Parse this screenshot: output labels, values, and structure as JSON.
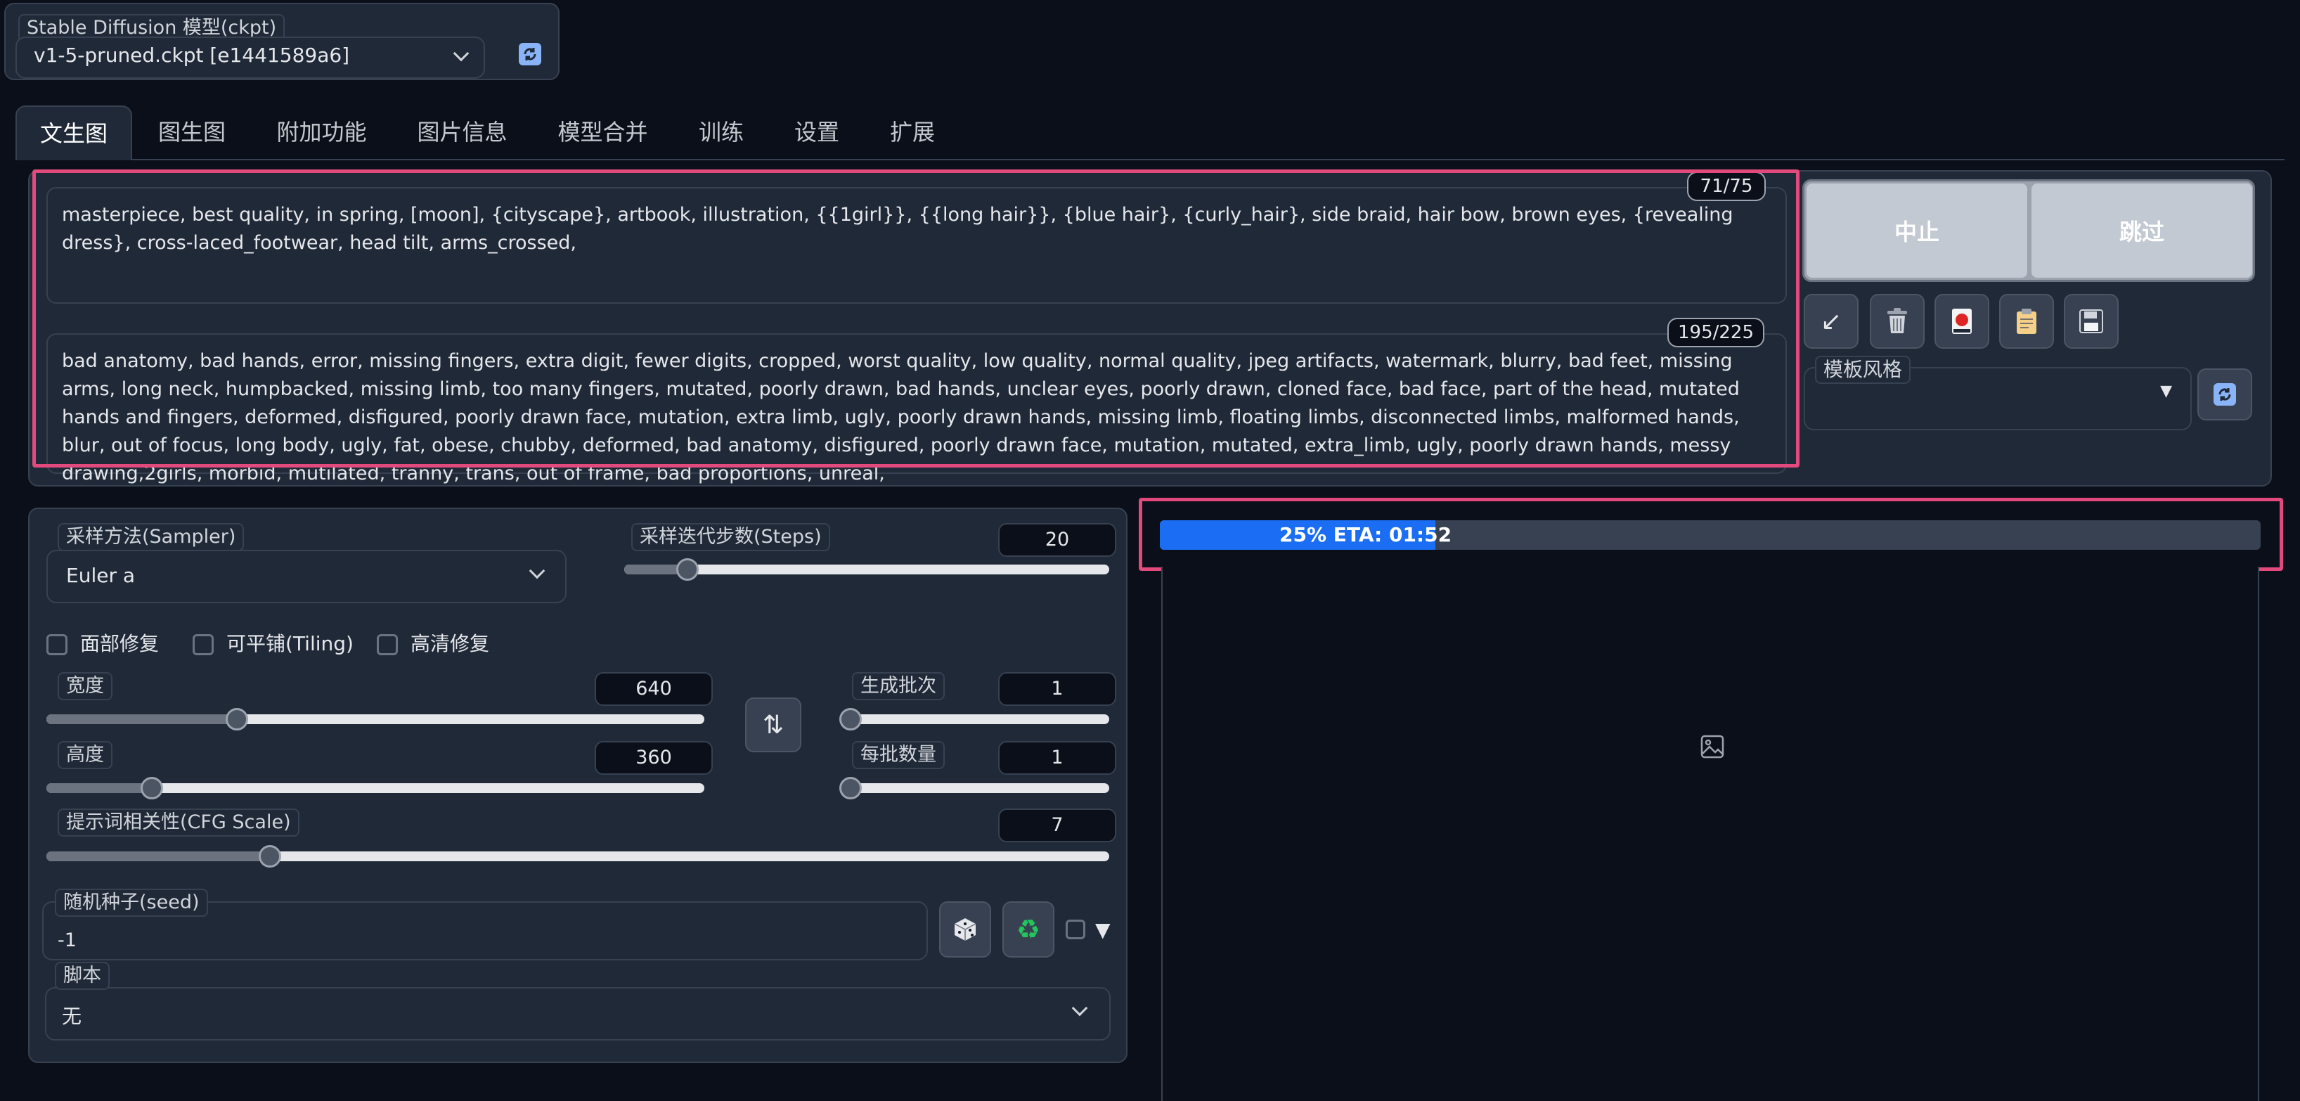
{
  "model": {
    "label": "Stable Diffusion 模型(ckpt)",
    "value": "v1-5-pruned.ckpt [e1441589a6]"
  },
  "tabs": [
    {
      "label": "文生图",
      "active": true
    },
    {
      "label": "图生图"
    },
    {
      "label": "附加功能"
    },
    {
      "label": "图片信息"
    },
    {
      "label": "模型合并"
    },
    {
      "label": "训练"
    },
    {
      "label": "设置"
    },
    {
      "label": "扩展"
    }
  ],
  "prompt": {
    "counter": "71/75",
    "text": "masterpiece, best quality, in spring, [moon], {cityscape}, artbook, illustration, {{1girl}}, {{long hair}}, {blue hair}, {curly_hair}, side braid, hair bow, brown eyes, {revealing dress}, cross-laced_footwear, head tilt, arms_crossed,"
  },
  "negative_prompt": {
    "counter": "195/225",
    "text": "bad anatomy, bad hands, error, missing fingers, extra digit, fewer digits, cropped, worst quality, low quality, normal quality, jpeg artifacts, watermark, blurry, bad feet, missing arms, long neck, humpbacked, missing limb, too many fingers, mutated, poorly drawn, bad hands, unclear eyes, poorly drawn, cloned face, bad face, part of the head, mutated hands and fingers, deformed, disfigured, poorly drawn face, mutation, extra limb, ugly, poorly drawn hands, missing limb, floating limbs, disconnected limbs, malformed hands, blur, out of focus, long body, ugly, fat, obese, chubby, deformed, bad anatomy, disfigured, poorly drawn face, mutation, mutated, extra_limb, ugly, poorly drawn hands, messy drawing,2girls, morbid, mutilated, tranny, trans, out of frame, bad proportions, unreal,"
  },
  "actions": {
    "interrupt": "中止",
    "skip": "跳过"
  },
  "style": {
    "label": "模板风格"
  },
  "sampler": {
    "label": "采样方法(Sampler)",
    "value": "Euler a"
  },
  "steps": {
    "label": "采样迭代步数(Steps)",
    "value": "20",
    "fraction": 0.13
  },
  "options": {
    "face_restore": "面部修复",
    "tiling": "可平铺(Tiling)",
    "hires_fix": "高清修复"
  },
  "width": {
    "label": "宽度",
    "value": "640",
    "fraction": 0.29
  },
  "height": {
    "label": "高度",
    "value": "360",
    "fraction": 0.16
  },
  "batch_count": {
    "label": "生成批次",
    "value": "1",
    "fraction": 0.0
  },
  "batch_size": {
    "label": "每批数量",
    "value": "1",
    "fraction": 0.0
  },
  "cfg": {
    "label": "提示词相关性(CFG Scale)",
    "value": "7",
    "fraction": 0.21
  },
  "seed": {
    "label": "随机种子(seed)",
    "value": "-1"
  },
  "script": {
    "label": "脚本",
    "value": "无"
  },
  "progress": {
    "text": "25% ETA: 01:52",
    "percent": 25
  },
  "colors": {
    "accent": "#e24a7e",
    "progress": "#1b6ef3",
    "background": "#0b0f19",
    "panel": "#1f2937"
  }
}
